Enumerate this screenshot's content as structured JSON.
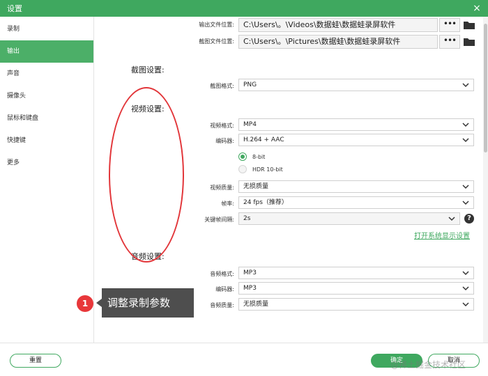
{
  "window": {
    "title": "设置",
    "close_glyph": "×"
  },
  "sidebar": {
    "items": [
      {
        "label": "录制",
        "active": false
      },
      {
        "label": "输出",
        "active": true
      },
      {
        "label": "声音",
        "active": false
      },
      {
        "label": "摄像头",
        "active": false
      },
      {
        "label": "鼠标和键盘",
        "active": false
      },
      {
        "label": "快捷键",
        "active": false
      },
      {
        "label": "更多",
        "active": false
      }
    ]
  },
  "output": {
    "video_location_label": "输出文件位置:",
    "video_location_value": "C:\\Users\\。\\Videos\\数据蛙\\数据蛙录屏软件",
    "screenshot_location_label": "截图文件位置:",
    "screenshot_location_value": "C:\\Users\\。\\Pictures\\数据蛙\\数据蛙录屏软件",
    "browse_glyph": "•••",
    "folder_icon": "folder-icon"
  },
  "screenshot_settings": {
    "section_label": "截图设置:",
    "format_label": "截图格式:",
    "format_value": "PNG"
  },
  "video_settings": {
    "section_label": "视频设置:",
    "format_label": "视频格式:",
    "format_value": "MP4",
    "encoder_label": "编码器:",
    "encoder_value": "H.264 + AAC",
    "bitdepth_options": [
      {
        "label": "8-bit",
        "selected": true
      },
      {
        "label": "HDR 10-bit",
        "selected": false
      }
    ],
    "quality_label": "视频质量:",
    "quality_value": "无损质量",
    "framerate_label": "帧率:",
    "framerate_value": "24 fps（推荐）",
    "keyframe_label": "关键帧间隔:",
    "keyframe_value": "2s",
    "help_glyph": "?",
    "display_settings_link": "打开系统显示设置"
  },
  "audio_settings": {
    "section_label": "音频设置:",
    "format_label": "音频格式:",
    "format_value": "MP3",
    "encoder_label": "编码器:",
    "encoder_value": "MP3",
    "quality_label": "音频质量:",
    "quality_value": "无损质量"
  },
  "footer": {
    "reset_label": "重置",
    "ok_label": "确定",
    "cancel_label": "取消"
  },
  "annotation": {
    "badge_number": "1",
    "callout_text": "调整录制参数",
    "color": "#e2363a"
  },
  "watermark": "@稀土掘金技术社区",
  "colors": {
    "accent": "#3fa85f",
    "annotation": "#e2363a"
  }
}
